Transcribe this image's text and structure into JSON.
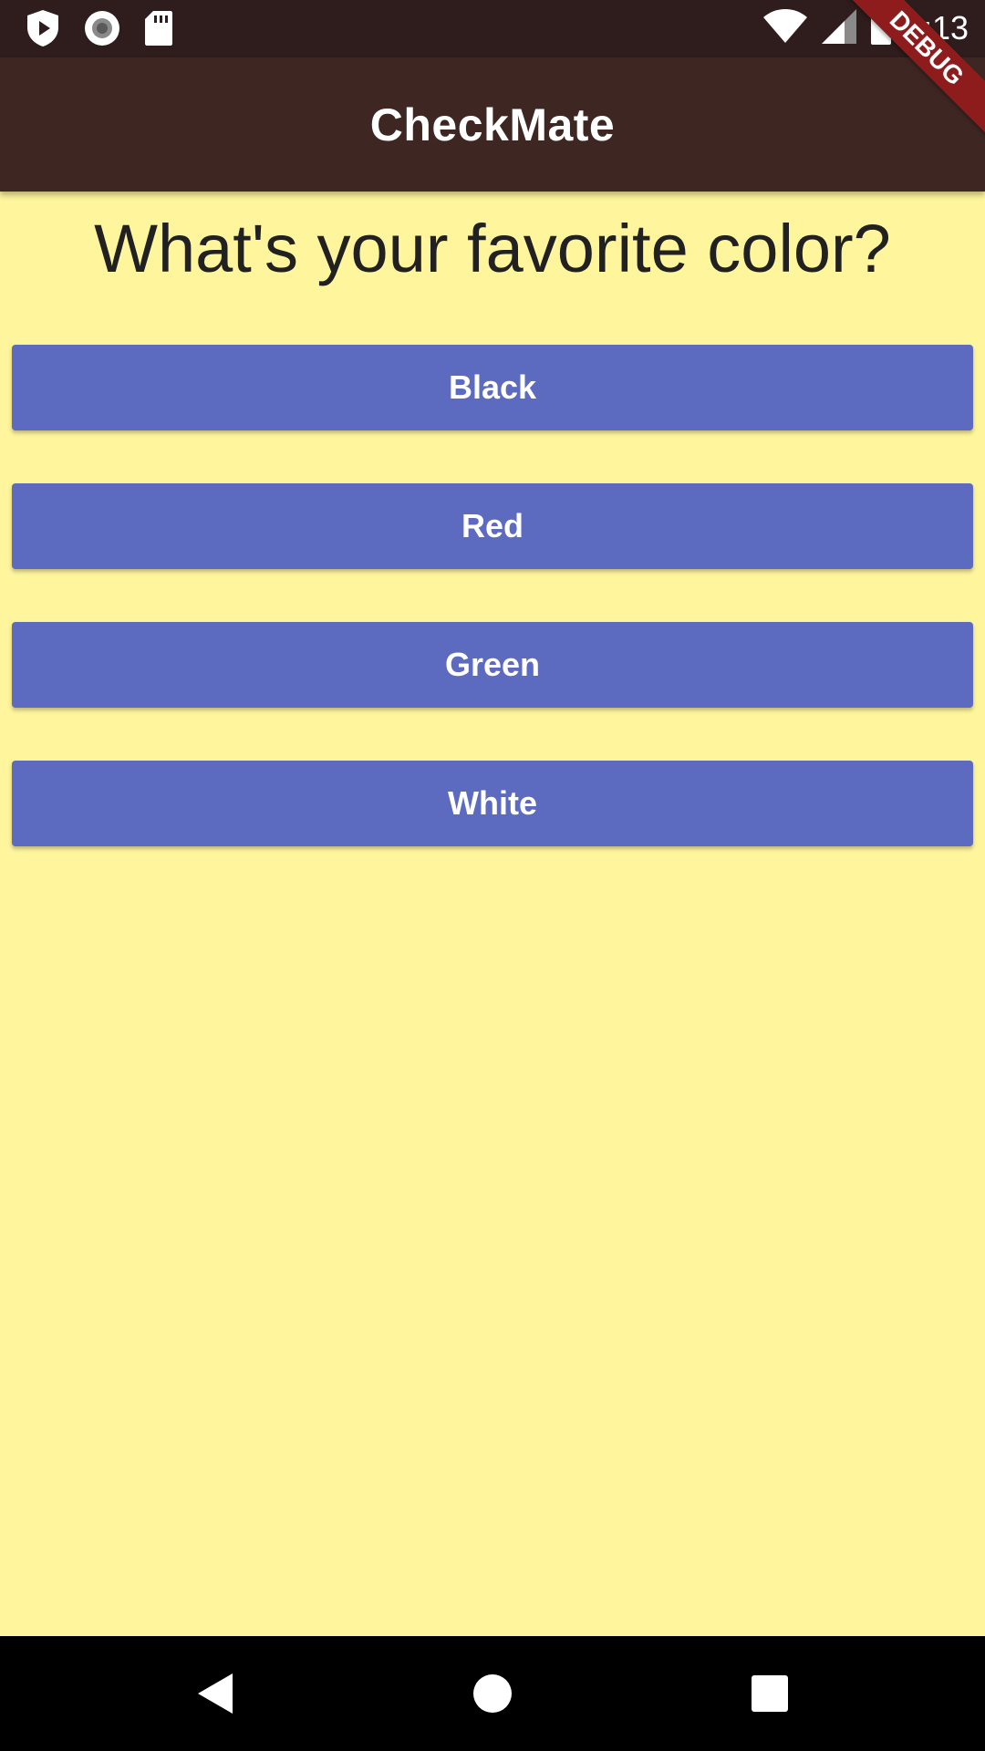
{
  "status_bar": {
    "time": "4:13",
    "icons": [
      "shield-play-icon",
      "radio-icon",
      "sd-card-icon",
      "wifi-icon",
      "signal-icon",
      "battery-icon"
    ]
  },
  "app_bar": {
    "title": "CheckMate",
    "color": "#3E2723"
  },
  "debug_banner": {
    "label": "DEBUG",
    "color": "#8E1C1C"
  },
  "main": {
    "background": "#FFF59D",
    "question": "What's your favorite color?",
    "answers": [
      {
        "label": "Black"
      },
      {
        "label": "Red"
      },
      {
        "label": "Green"
      },
      {
        "label": "White"
      }
    ],
    "button_color": "#5C6BC0"
  },
  "nav_bar": {
    "icons": [
      "back-icon",
      "home-icon",
      "recents-icon"
    ]
  }
}
